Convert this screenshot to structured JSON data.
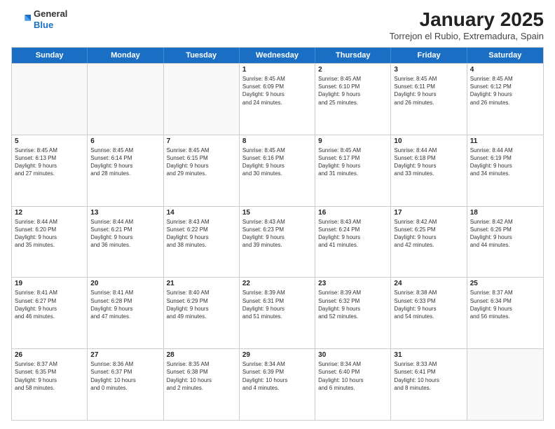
{
  "logo": {
    "general": "General",
    "blue": "Blue"
  },
  "header": {
    "month": "January 2025",
    "location": "Torrejon el Rubio, Extremadura, Spain"
  },
  "weekdays": [
    "Sunday",
    "Monday",
    "Tuesday",
    "Wednesday",
    "Thursday",
    "Friday",
    "Saturday"
  ],
  "weeks": [
    [
      {
        "day": "",
        "text": ""
      },
      {
        "day": "",
        "text": ""
      },
      {
        "day": "",
        "text": ""
      },
      {
        "day": "1",
        "text": "Sunrise: 8:45 AM\nSunset: 6:09 PM\nDaylight: 9 hours\nand 24 minutes."
      },
      {
        "day": "2",
        "text": "Sunrise: 8:45 AM\nSunset: 6:10 PM\nDaylight: 9 hours\nand 25 minutes."
      },
      {
        "day": "3",
        "text": "Sunrise: 8:45 AM\nSunset: 6:11 PM\nDaylight: 9 hours\nand 26 minutes."
      },
      {
        "day": "4",
        "text": "Sunrise: 8:45 AM\nSunset: 6:12 PM\nDaylight: 9 hours\nand 26 minutes."
      }
    ],
    [
      {
        "day": "5",
        "text": "Sunrise: 8:45 AM\nSunset: 6:13 PM\nDaylight: 9 hours\nand 27 minutes."
      },
      {
        "day": "6",
        "text": "Sunrise: 8:45 AM\nSunset: 6:14 PM\nDaylight: 9 hours\nand 28 minutes."
      },
      {
        "day": "7",
        "text": "Sunrise: 8:45 AM\nSunset: 6:15 PM\nDaylight: 9 hours\nand 29 minutes."
      },
      {
        "day": "8",
        "text": "Sunrise: 8:45 AM\nSunset: 6:16 PM\nDaylight: 9 hours\nand 30 minutes."
      },
      {
        "day": "9",
        "text": "Sunrise: 8:45 AM\nSunset: 6:17 PM\nDaylight: 9 hours\nand 31 minutes."
      },
      {
        "day": "10",
        "text": "Sunrise: 8:44 AM\nSunset: 6:18 PM\nDaylight: 9 hours\nand 33 minutes."
      },
      {
        "day": "11",
        "text": "Sunrise: 8:44 AM\nSunset: 6:19 PM\nDaylight: 9 hours\nand 34 minutes."
      }
    ],
    [
      {
        "day": "12",
        "text": "Sunrise: 8:44 AM\nSunset: 6:20 PM\nDaylight: 9 hours\nand 35 minutes."
      },
      {
        "day": "13",
        "text": "Sunrise: 8:44 AM\nSunset: 6:21 PM\nDaylight: 9 hours\nand 36 minutes."
      },
      {
        "day": "14",
        "text": "Sunrise: 8:43 AM\nSunset: 6:22 PM\nDaylight: 9 hours\nand 38 minutes."
      },
      {
        "day": "15",
        "text": "Sunrise: 8:43 AM\nSunset: 6:23 PM\nDaylight: 9 hours\nand 39 minutes."
      },
      {
        "day": "16",
        "text": "Sunrise: 8:43 AM\nSunset: 6:24 PM\nDaylight: 9 hours\nand 41 minutes."
      },
      {
        "day": "17",
        "text": "Sunrise: 8:42 AM\nSunset: 6:25 PM\nDaylight: 9 hours\nand 42 minutes."
      },
      {
        "day": "18",
        "text": "Sunrise: 8:42 AM\nSunset: 6:26 PM\nDaylight: 9 hours\nand 44 minutes."
      }
    ],
    [
      {
        "day": "19",
        "text": "Sunrise: 8:41 AM\nSunset: 6:27 PM\nDaylight: 9 hours\nand 46 minutes."
      },
      {
        "day": "20",
        "text": "Sunrise: 8:41 AM\nSunset: 6:28 PM\nDaylight: 9 hours\nand 47 minutes."
      },
      {
        "day": "21",
        "text": "Sunrise: 8:40 AM\nSunset: 6:29 PM\nDaylight: 9 hours\nand 49 minutes."
      },
      {
        "day": "22",
        "text": "Sunrise: 8:39 AM\nSunset: 6:31 PM\nDaylight: 9 hours\nand 51 minutes."
      },
      {
        "day": "23",
        "text": "Sunrise: 8:39 AM\nSunset: 6:32 PM\nDaylight: 9 hours\nand 52 minutes."
      },
      {
        "day": "24",
        "text": "Sunrise: 8:38 AM\nSunset: 6:33 PM\nDaylight: 9 hours\nand 54 minutes."
      },
      {
        "day": "25",
        "text": "Sunrise: 8:37 AM\nSunset: 6:34 PM\nDaylight: 9 hours\nand 56 minutes."
      }
    ],
    [
      {
        "day": "26",
        "text": "Sunrise: 8:37 AM\nSunset: 6:35 PM\nDaylight: 9 hours\nand 58 minutes."
      },
      {
        "day": "27",
        "text": "Sunrise: 8:36 AM\nSunset: 6:37 PM\nDaylight: 10 hours\nand 0 minutes."
      },
      {
        "day": "28",
        "text": "Sunrise: 8:35 AM\nSunset: 6:38 PM\nDaylight: 10 hours\nand 2 minutes."
      },
      {
        "day": "29",
        "text": "Sunrise: 8:34 AM\nSunset: 6:39 PM\nDaylight: 10 hours\nand 4 minutes."
      },
      {
        "day": "30",
        "text": "Sunrise: 8:34 AM\nSunset: 6:40 PM\nDaylight: 10 hours\nand 6 minutes."
      },
      {
        "day": "31",
        "text": "Sunrise: 8:33 AM\nSunset: 6:41 PM\nDaylight: 10 hours\nand 8 minutes."
      },
      {
        "day": "",
        "text": ""
      }
    ]
  ]
}
